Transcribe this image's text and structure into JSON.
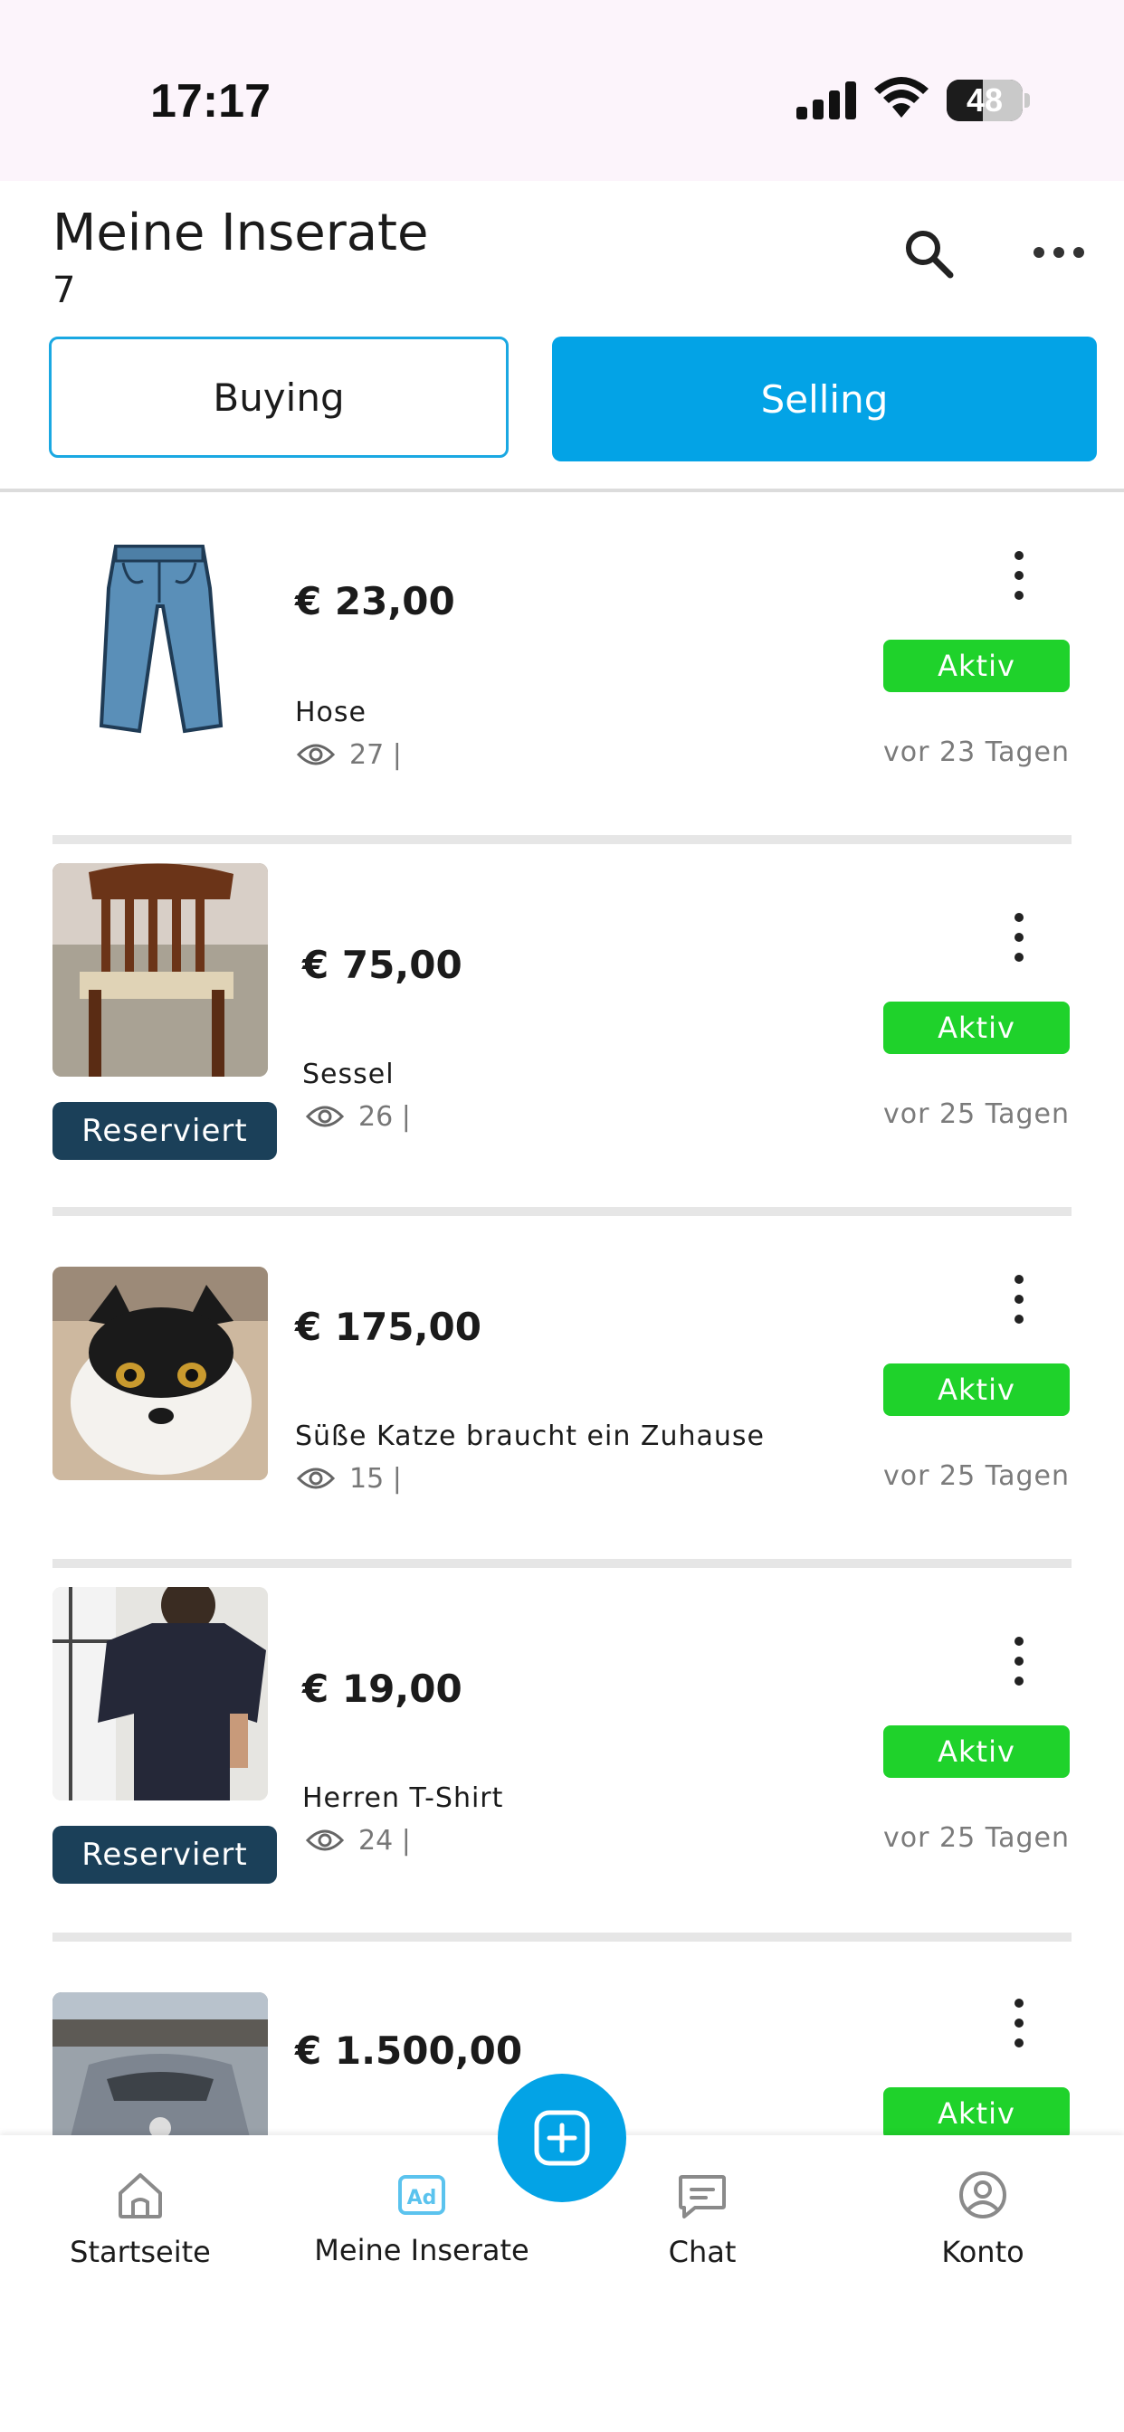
{
  "status_bar": {
    "time": "17:17",
    "battery": "48",
    "battery_level_percent": 48
  },
  "header": {
    "title": "Meine Inserate",
    "count": "7"
  },
  "tabs": {
    "buying": "Buying",
    "selling": "Selling",
    "active": "selling"
  },
  "listings": [
    {
      "price": "€ 23,00",
      "title": "Hose",
      "views": "27 |",
      "status": "Aktiv",
      "age": "vor 23 Tagen",
      "reserved": "",
      "image": "jeans-image"
    },
    {
      "price": "€ 75,00",
      "title": "Sessel",
      "views": "26 |",
      "status": "Aktiv",
      "age": "vor 25 Tagen",
      "reserved": "Reserviert",
      "image": "chair-photo"
    },
    {
      "price": "€ 175,00",
      "title": "Süße Katze braucht ein Zuhause",
      "views": "15 |",
      "status": "Aktiv",
      "age": "vor 25 Tagen",
      "reserved": "",
      "image": "cat-photo"
    },
    {
      "price": "€ 19,00",
      "title": "Herren T-Shirt",
      "views": "24 |",
      "status": "Aktiv",
      "age": "vor 25 Tagen",
      "reserved": "Reserviert",
      "image": "tshirt-photo"
    },
    {
      "price": "€ 1.500,00",
      "title": "",
      "views": "",
      "status": "Aktiv",
      "age": "",
      "reserved": "",
      "image": "car-photo"
    }
  ],
  "bottom_nav": {
    "items": [
      {
        "label": "Startseite",
        "icon": "home-icon"
      },
      {
        "label": "Meine Inserate",
        "icon": "ad-icon"
      },
      {
        "label": "Chat",
        "icon": "chat-icon"
      },
      {
        "label": "Konto",
        "icon": "user-icon"
      }
    ],
    "fab_icon": "plus-icon"
  },
  "colors": {
    "accent": "#03a3e6",
    "active_badge": "#1fd22b",
    "reserved_badge": "#1b4059",
    "status_bar_bg": "#fcf4fb"
  }
}
